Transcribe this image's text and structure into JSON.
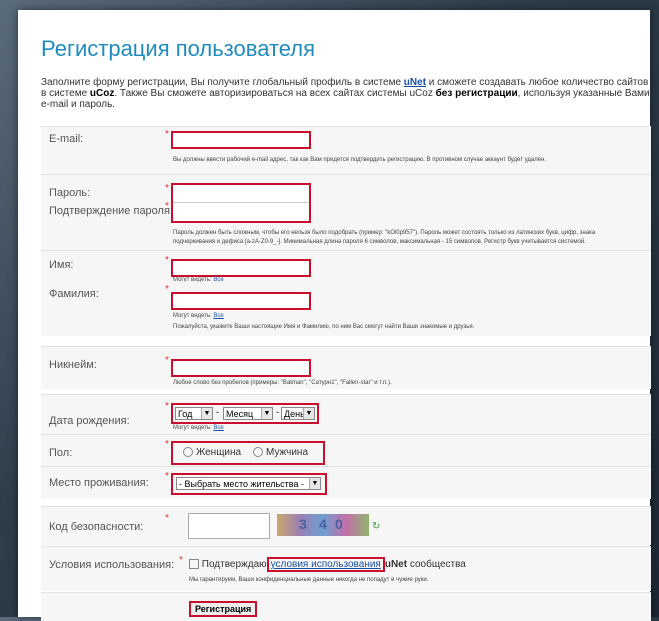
{
  "title": "Регистрация пользователя",
  "intro": {
    "part1": "Заполните форму регистрации, Вы получите глобальный профиль в системе ",
    "unet": "uNet",
    "part2": " и сможете создавать любое количество сайтов в системе ",
    "ucoz": "uCoz",
    "part3": ". Также Вы сможете авторизироваться на всех сайтах системы uCoz ",
    "no_reg": "без регистрации",
    "part4": ", используя указанные Вами e-mail и пароль."
  },
  "fields": {
    "email": {
      "label": "E-mail:",
      "hint": "Вы должны ввести рабочий e-mail адрес, так как Вам придется подтвердить регистрацию. В противном случае аккаунт будет удален."
    },
    "password": {
      "label": "Пароль:"
    },
    "password_confirm": {
      "label": "Подтверждение пароля:",
      "hint1": "Пароль должен быть сложным, чтобы его нельзя было подобрать (пример: \"kOi0p957\"). Пароль может состоять только из латинских букв, цифр, знака",
      "hint2": "подчеркивания и дефиса [a-zA-Z0-9_-]. Минимальная длина пароля 6 символов, максимальная - 15 символов. Регистр букв учитывается системой."
    },
    "name": {
      "label": "Имя:",
      "visible_prefix": "Могут видеть:",
      "visible_link": "Все"
    },
    "surname": {
      "label": "Фамилия:",
      "visible_prefix": "Могут видеть:",
      "visible_link": "Все",
      "hint": "Пожалуйста, укажите Ваши настоящие Имя и Фамилию, по ним Вас смогут найти Ваши знакомые и друзья."
    },
    "nickname": {
      "label": "Никнейм:",
      "hint": "Любое слово без пробелов (примеры: \"Batman\", \"Сатурн1\", \"Fallen-star\" и т.п.)."
    },
    "birthdate": {
      "label": "Дата рождения:",
      "year": "Год",
      "month": "Месяц",
      "day": "День",
      "sep": "-",
      "visible_prefix": "Могут видеть:",
      "visible_link": "Все"
    },
    "gender": {
      "label": "Пол:",
      "female": "Женщина",
      "male": "Мужчина"
    },
    "residence": {
      "label": "Место проживания:",
      "value": "- Выбрать место жительства -"
    },
    "captcha": {
      "label": "Код безопасности:"
    },
    "terms": {
      "label": "Условия использования:",
      "prefix": "Подтверждаю",
      "link": "условия использования",
      "unet": "uNet",
      "suffix": "сообщества",
      "hint": "Мы гарантируем, Ваши конфиденциальные данные никогда не попадут в чужие руки."
    }
  },
  "submit_label": "Регистрация",
  "star": "*",
  "arrow": "▼",
  "colors": {
    "title": "#1f8bbf",
    "highlight": "#c8102e",
    "link": "#1a4fa6"
  }
}
